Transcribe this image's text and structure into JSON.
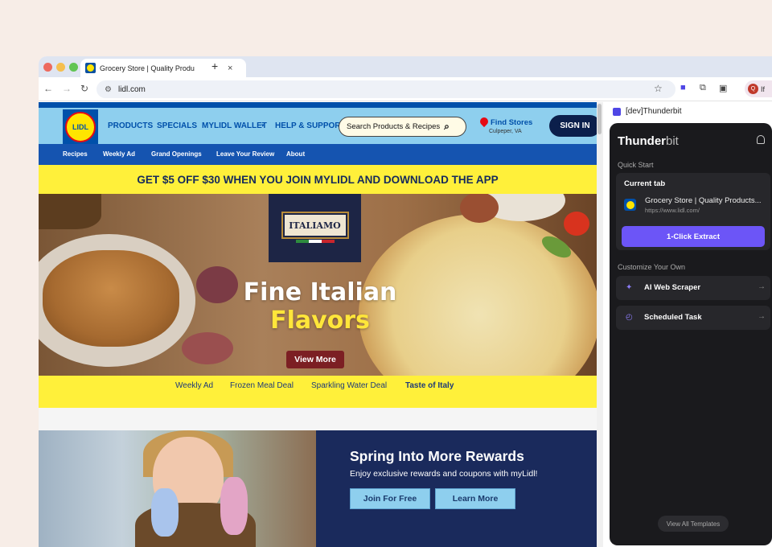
{
  "browser": {
    "tab_title": "Grocery Store | Quality Produ",
    "tab_close": "×",
    "new_tab": "+",
    "url": "lidl.com",
    "profile_initial": "Q",
    "profile_label": "If"
  },
  "lidl": {
    "logo": "LIDL",
    "nav": [
      "PRODUCTS",
      "SPECIALS",
      "MYLIDL WALLET",
      "HELP & SUPPORT"
    ],
    "search_placeholder": "Search Products & Recipes",
    "find_stores": "Find Stores",
    "store_location": "Culpeper, VA",
    "sign_in": "SIGN IN",
    "subnav": [
      "Recipes",
      "Weekly Ad",
      "Grand Openings",
      "Leave Your Review",
      "About"
    ],
    "promo": "GET $5 OFF $30 WHEN YOU JOIN MYLIDL AND DOWNLOAD THE APP",
    "hero": {
      "brand": "ITALIAMO",
      "title_line1": "Fine Italian",
      "title_line2": "Flavors",
      "cta": "View More"
    },
    "quick_links": [
      "Weekly Ad",
      "Frozen Meal Deal",
      "Sparkling Water Deal",
      "Taste of Italy"
    ],
    "rewards": {
      "title": "Spring Into More Rewards",
      "subtitle": "Enjoy exclusive rewards and coupons with myLidl!",
      "join": "Join For Free",
      "learn": "Learn More"
    }
  },
  "extension": {
    "header": "[dev]Thunderbit",
    "brand_a": "Thunder",
    "brand_b": "bit",
    "quick_start": "Quick Start",
    "current_tab": "Current tab",
    "page_title": "Grocery Store | Quality Products...",
    "page_url": "https://www.lidl.com/",
    "extract": "1-Click Extract",
    "customize": "Customize Your Own",
    "items": [
      "AI Web Scraper",
      "Scheduled Task"
    ],
    "templates": "View All Templates"
  },
  "colors": {
    "lidl_blue": "#0050aa",
    "lidl_yellow": "#fff03a",
    "accent_purple": "#6c55f7"
  }
}
